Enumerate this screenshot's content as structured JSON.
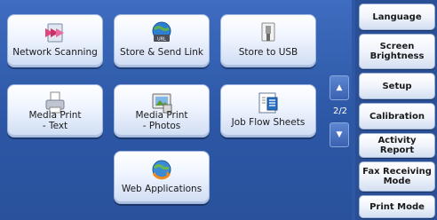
{
  "tiles": [
    {
      "label": "Network Scanning",
      "icon": "network-scanning-icon"
    },
    {
      "label": "Store & Send Link",
      "icon": "store-send-link-icon"
    },
    {
      "label": "Store to USB",
      "icon": "store-to-usb-icon"
    },
    {
      "label": "Media Print\n- Text",
      "icon": "media-print-text-icon"
    },
    {
      "label": "Media Print\n- Photos",
      "icon": "media-print-photos-icon"
    },
    {
      "label": "Job Flow Sheets",
      "icon": "job-flow-sheets-icon"
    },
    {
      "label": "Web Applications",
      "icon": "web-applications-icon"
    }
  ],
  "pager": {
    "indicator": "2/2",
    "up": "▲",
    "down": "▼"
  },
  "sidebar": [
    {
      "label": "Language"
    },
    {
      "label": "Screen\nBrightness"
    },
    {
      "label": "Setup"
    },
    {
      "label": "Calibration"
    },
    {
      "label": "Activity Report"
    },
    {
      "label": "Fax Receiving\nMode"
    },
    {
      "label": "Print Mode"
    }
  ],
  "colors": {
    "background": "#2f58a4",
    "tile": "#eef4ff",
    "sidebar": "#2a4f95",
    "accent": "#e0457e"
  }
}
